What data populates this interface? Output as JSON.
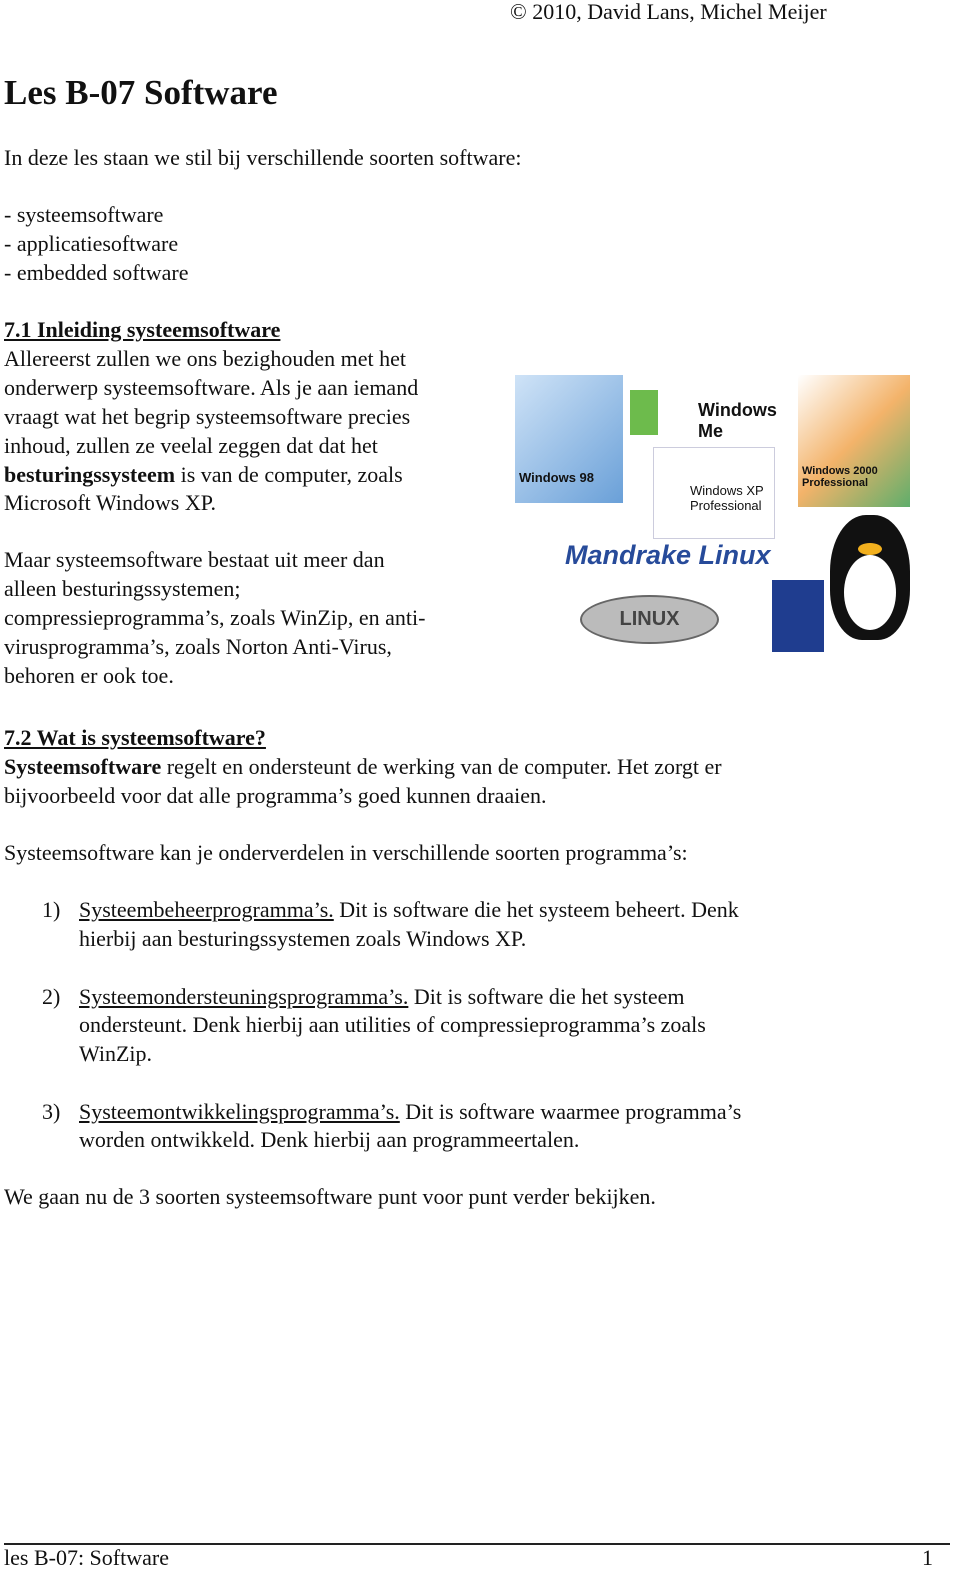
{
  "header": {
    "copyright": "© 2010, David Lans, Michel Meijer"
  },
  "title": "Les B-07 Software",
  "intro": "In deze les staan we stil bij verschillende soorten software:",
  "topics": [
    "- systeemsoftware",
    "- applicatiesoftware",
    "- embedded software"
  ],
  "s71": {
    "heading": "7.1 Inleiding systeemsoftware",
    "p1": [
      "Allereerst zullen we ons bezighouden met het",
      "onderwerp systeemsoftware. Als je aan iemand",
      "vraagt wat het begrip systeemsoftware precies",
      "inhoud, zullen ze veelal zeggen dat dat het"
    ],
    "p1_bold": "besturingssysteem",
    "p1_rest": " is van de computer, zoals",
    "p1_last": "Microsoft Windows XP.",
    "p2": [
      "Maar systeemsoftware bestaat uit meer dan",
      "alleen besturingssystemen;",
      "compressieprogramma’s, zoals WinZip, en anti-",
      "virusprogramma’s, zoals Norton Anti-Virus,",
      "behoren er ook toe."
    ]
  },
  "image": {
    "labels": [
      "Windows 98",
      "Windows Me",
      "Windows 2000 Professional",
      "Windows XP Professional",
      "Mandrake Linux",
      "LINUX"
    ]
  },
  "s72": {
    "heading": "7.2 Wat is systeemsoftware?",
    "bold": "Systeemsoftware",
    "l1": " regelt en ondersteunt de werking van de computer. Het zorgt er",
    "l2": "bijvoorbeeld voor dat alle programma’s goed kunnen draaien.",
    "l3": "Systeemsoftware kan je onderverdelen in verschillende soorten programma’s:",
    "items": [
      {
        "n": "1)",
        "term": "Systeembeheerprogramma’s.",
        "l1": " Dit is software die het systeem beheert. Denk",
        "l2": "hierbij aan besturingssystemen zoals Windows XP."
      },
      {
        "n": "2)",
        "term": "Systeemondersteuningsprogramma’s.",
        "l1": " Dit is software die het systeem",
        "l2": "ondersteunt. Denk hierbij aan utilities of compressieprogramma’s zoals",
        "l3": "WinZip."
      },
      {
        "n": "3)",
        "term": "Systeemontwikkelingsprogramma’s.",
        "l1": " Dit is software waarmee programma’s",
        "l2": "worden ontwikkeld. Denk hierbij aan programmeertalen."
      }
    ],
    "closing": "We gaan nu de 3 soorten systeemsoftware punt voor punt verder bekijken."
  },
  "footer": {
    "left": "les B-07: Software",
    "page": "1"
  }
}
